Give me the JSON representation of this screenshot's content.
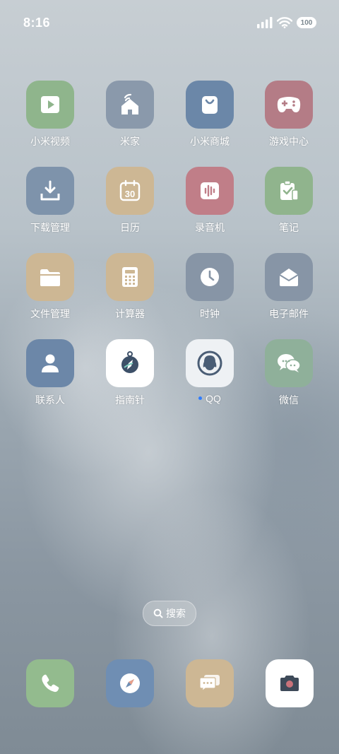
{
  "status": {
    "time": "8:16",
    "battery": "100"
  },
  "apps": [
    {
      "name": "小米视频",
      "color": "#8fb58c"
    },
    {
      "name": "米家",
      "color": "#8a99ab"
    },
    {
      "name": "小米商城",
      "color": "#6b87a8"
    },
    {
      "name": "游戏中心",
      "color": "#b47c86"
    },
    {
      "name": "下载管理",
      "color": "#7e93ab"
    },
    {
      "name": "日历",
      "color": "#cdb794"
    },
    {
      "name": "录音机",
      "color": "#c07e88"
    },
    {
      "name": "笔记",
      "color": "#90b48d"
    },
    {
      "name": "文件管理",
      "color": "#cdb794"
    },
    {
      "name": "计算器",
      "color": "#cdb794"
    },
    {
      "name": "时钟",
      "color": "#8795a6"
    },
    {
      "name": "电子邮件",
      "color": "#8795a6"
    },
    {
      "name": "联系人",
      "color": "#6c87a8"
    },
    {
      "name": "指南针",
      "color": "#ffffff"
    },
    {
      "name": "QQ",
      "color": "#eef1f4"
    },
    {
      "name": "微信",
      "color": "#8fb09a"
    }
  ],
  "search": {
    "label": "搜索"
  },
  "dock": [
    {
      "name": "phone",
      "color": "#93bb8e"
    },
    {
      "name": "browser",
      "color": "#6f8eb3"
    },
    {
      "name": "messages",
      "color": "#cdb794"
    },
    {
      "name": "camera",
      "color": "#ffffff"
    }
  ]
}
